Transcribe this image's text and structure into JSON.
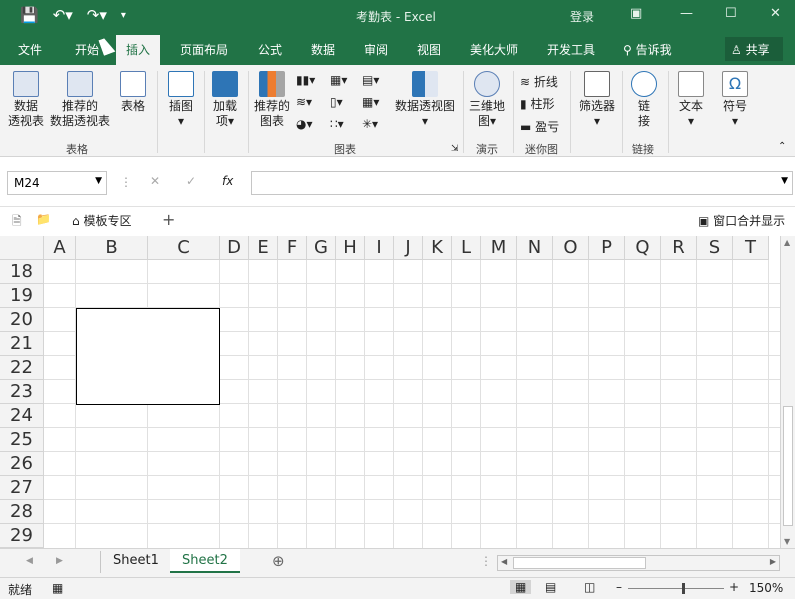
{
  "window": {
    "doc_title": "考勤表",
    "sep": "-",
    "app": "Excel",
    "login": "登录"
  },
  "ribbon_tabs": [
    "文件",
    "开始",
    "插入",
    "页面布局",
    "公式",
    "数据",
    "审阅",
    "视图",
    "美化大师",
    "开发工具"
  ],
  "tellme": "告诉我",
  "share": "共享",
  "ribbon": {
    "pivot_1": "数据",
    "pivot_2": "透视表",
    "rec_pivot_1": "推荐的",
    "rec_pivot_2": "数据透视表",
    "table": "表格",
    "illustrations": "插图",
    "addins_1": "加载",
    "addins_2": "项",
    "rec_charts_1": "推荐的",
    "rec_charts_2": "图表",
    "pivot_chart": "数据透视图",
    "map3d_1": "三维地",
    "map3d_2": "图",
    "spark_line": "折线",
    "spark_col": "柱形",
    "spark_wl": "盈亏",
    "filter": "筛选器",
    "link_1": "链",
    "link_2": "接",
    "text": "文本",
    "symbol": "符号",
    "groups": {
      "tables": "表格",
      "charts": "图表",
      "tours": "演示",
      "sparklines": "迷你图",
      "links": "链接"
    }
  },
  "namebox": "M24",
  "fx": "fx",
  "template_zone": "模板专区",
  "window_merge": "窗口合并显示",
  "columns": [
    "A",
    "B",
    "C",
    "D",
    "E",
    "F",
    "G",
    "H",
    "I",
    "J",
    "K",
    "L",
    "M",
    "N",
    "O",
    "P",
    "Q",
    "R",
    "S",
    "T"
  ],
  "rows": [
    "18",
    "19",
    "20",
    "21",
    "22",
    "23",
    "24",
    "25",
    "26",
    "27",
    "28",
    "29"
  ],
  "sheets": [
    "Sheet1",
    "Sheet2"
  ],
  "active_sheet": "Sheet2",
  "status": {
    "ready": "就绪",
    "zoom": "150%"
  }
}
